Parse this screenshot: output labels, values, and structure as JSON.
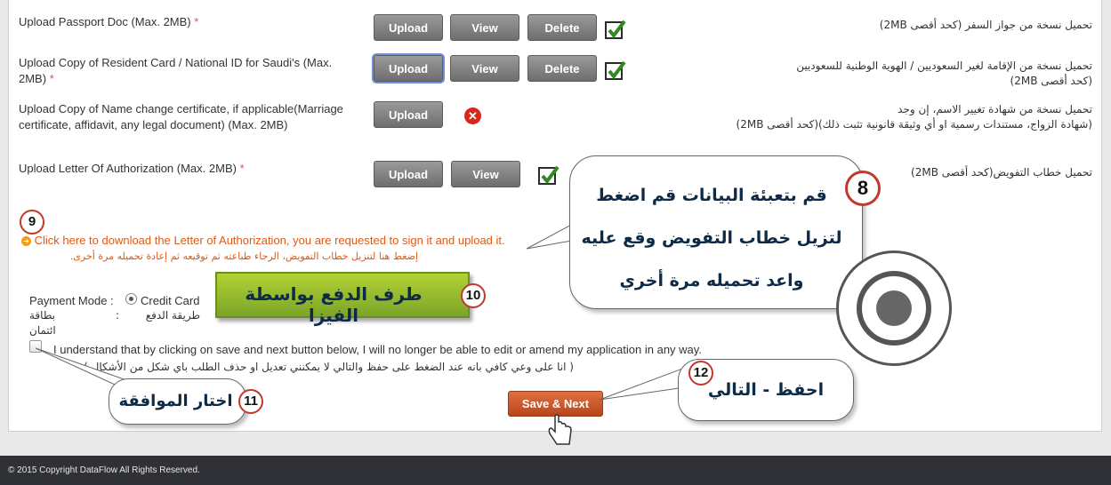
{
  "rows": [
    {
      "label": "Upload Passport Doc (Max. 2MB)",
      "arabic": "تحميل نسخة من جواز السفر (كحد أقصى 2MB)"
    },
    {
      "label_line1": "Upload Copy of Resident Card / National ID for Saudi's (Max.",
      "label_line2": "2MB)",
      "arabic_line1": "تحميل نسخة من الإقامة لغير السعوديين / الهوية الوطنية للسعوديين",
      "arabic_line2": "(كحد أقصى 2MB)"
    },
    {
      "label_line1": "Upload Copy of Name change certificate, if applicable(Marriage",
      "label_line2": "certificate, affidavit, any legal document) (Max. 2MB)",
      "arabic_line1": "تحميل نسخة من شهادة تغيير الاسم، إن وجد",
      "arabic_line2": "(شهادة الزواج، مستندات رسمية او أي وثيقة قانونية تثبت ذلك)(كحد أقصى 2MB)"
    },
    {
      "label": "Upload Letter Of Authorization (Max. 2MB)",
      "arabic": "تحميل خطاب التفويض(كحد أقصى 2MB)"
    }
  ],
  "required_mark": "*",
  "buttons": {
    "upload": "Upload",
    "view": "View",
    "delete": "Delete",
    "save_next": "Save & Next"
  },
  "download_link": {
    "text": "Click here to download the Letter of Authorization, you are requested to sign it and upload it.",
    "arabic_line1": "إضغط هنا لتنزيل خطاب التفويض، الرجاء طباعته ثم توقيعه ثم إعادة تحميله مرة أخرى.",
    "arabic_line2": ""
  },
  "payment": {
    "label": "Payment Mode :",
    "option": "Credit Card",
    "label_ar": "طريقة الدفع",
    "colon": ":",
    "option_ar": "بطاقة ائتمان"
  },
  "agreement": {
    "text": "I understand that by clicking on save and next button below, I will no longer be able to edit or amend my application in any way.",
    "arabic": "( انا على وعي كافي بانه عند الضغط على حفظ والتالي لا يمكنني تعديل او حذف الطلب باي شكل من الأشكال )"
  },
  "annotations": {
    "n8": "8",
    "n9": "9",
    "n10": "10",
    "n11": "11",
    "n12": "12",
    "bubble8_line1": "قم بتعبئة البيانات قم اضغط",
    "bubble8_line2": "لتزيل خطاب التفويض وقع عليه",
    "bubble8_line3": "واعد تحميله مرة أخري",
    "box10": "طرف الدفع بواسطة الفيزا",
    "bubble11": "اختار الموافقة",
    "bubble12": "احفظ - التالي"
  },
  "footer": "© 2015 Copyright DataFlow All Rights Reserved.",
  "colors": {
    "link": "#e05a14",
    "save_button": "#c9562a",
    "footer_bg": "#2f3136",
    "accent_green": "#9dc032"
  }
}
